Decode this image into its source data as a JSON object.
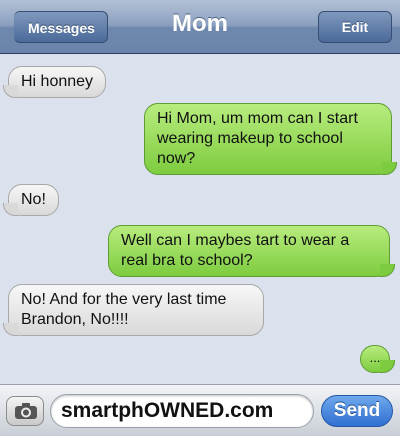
{
  "header": {
    "title": "Mom",
    "back_label": "Messages",
    "edit_label": "Edit"
  },
  "messages": [
    {
      "sender": "contact",
      "text": "Hi honney"
    },
    {
      "sender": "me",
      "text": "Hi Mom, um mom can I start wearing makeup to school now?"
    },
    {
      "sender": "contact",
      "text": "No!"
    },
    {
      "sender": "me",
      "text": "Well can I maybes tart to wear a real bra to school?"
    },
    {
      "sender": "contact",
      "text": "No! And for the very last time Brandon, No!!!!"
    }
  ],
  "typing_indicator": "...",
  "composer": {
    "value": "smartphOWNED.com",
    "send_label": "Send"
  },
  "colors": {
    "incoming_bubble": "#e6e6e6",
    "outgoing_bubble": "#9bdc5c",
    "navbar": "#7f95b8",
    "send_button": "#3b7fdc"
  },
  "icons": [
    "chevron-left-icon",
    "camera-icon"
  ]
}
